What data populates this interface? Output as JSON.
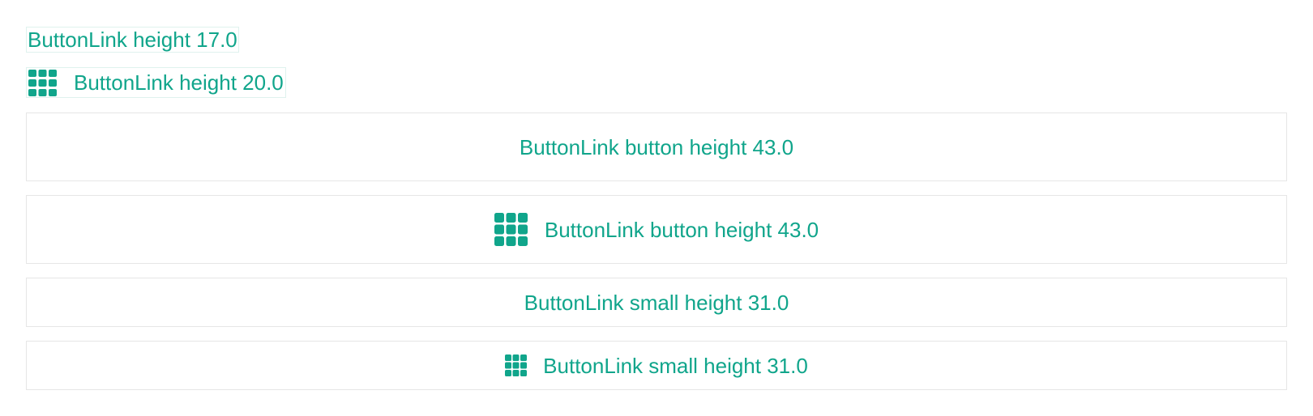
{
  "colors": {
    "accent": "#10a58b",
    "border": "#e6e6e6"
  },
  "links": [
    {
      "label": "ButtonLink height 17.0",
      "icon": null
    },
    {
      "label": "ButtonLink height 20.0",
      "icon": "grid-icon"
    }
  ],
  "buttons": [
    {
      "label": "ButtonLink button height 43.0",
      "icon": null
    },
    {
      "label": "ButtonLink button height 43.0",
      "icon": "grid-icon"
    }
  ],
  "small_buttons": [
    {
      "label": "ButtonLink small height 31.0",
      "icon": null
    },
    {
      "label": "ButtonLink small height 31.0",
      "icon": "grid-icon"
    }
  ]
}
